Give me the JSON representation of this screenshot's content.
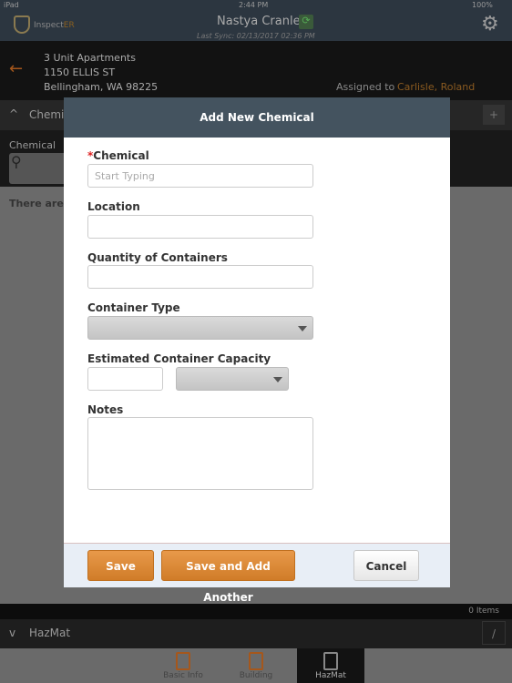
{
  "status": {
    "device": "iPad",
    "time": "2:44 PM",
    "battery": "100%"
  },
  "header": {
    "logo_prefix": "Inspect",
    "logo_suffix": "ER",
    "user": "Nastya Cranley",
    "last_sync": "Last Sync: 02/13/2017 02:36 PM"
  },
  "address": {
    "type": "3 Unit Apartments",
    "street": "1150 ELLIS ST",
    "city": "Bellingham, WA 98225",
    "assigned_label": "Assigned to",
    "assigned_name": "Carlisle, Roland"
  },
  "section": {
    "title": "Chemicals",
    "add": "+"
  },
  "filter": {
    "label": "Chemical"
  },
  "content": {
    "empty": "There are no chemicals"
  },
  "items_count": "0 Items",
  "hazmat_bar": {
    "title": "HazMat"
  },
  "tabs": [
    {
      "label": "Basic Info"
    },
    {
      "label": "Building"
    },
    {
      "label": "HazMat"
    }
  ],
  "modal": {
    "title": "Add New Chemical",
    "required_mark": "*",
    "chemical_label": "Chemical",
    "chemical_placeholder": "Start Typing",
    "location_label": "Location",
    "quantity_label": "Quantity of Containers",
    "container_type_label": "Container Type",
    "capacity_label": "Estimated Container Capacity",
    "notes_label": "Notes",
    "save": "Save",
    "save_add": "Save and Add Another",
    "cancel": "Cancel"
  }
}
